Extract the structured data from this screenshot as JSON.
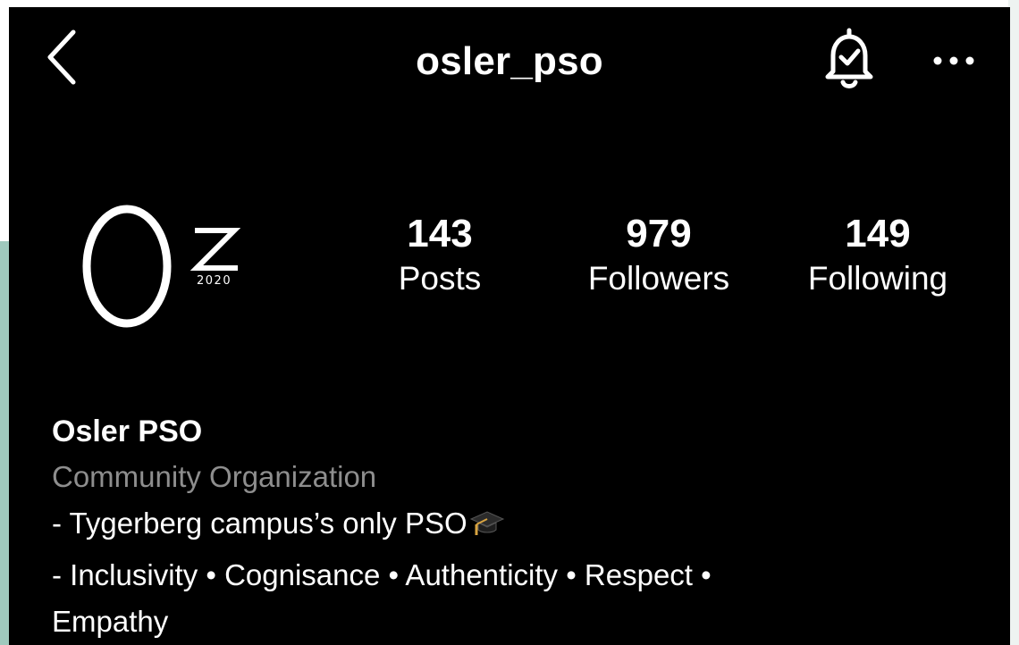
{
  "header": {
    "username": "osler_pso",
    "back_icon": "chevron-left-icon",
    "notify_icon": "bell-check-icon",
    "more_icon": "ellipsis-icon"
  },
  "avatar": {
    "logo_text": "OZ 2020"
  },
  "stats": {
    "posts_count": "143",
    "posts_label": "Posts",
    "followers_count": "979",
    "followers_label": "Followers",
    "following_count": "149",
    "following_label": "Following"
  },
  "bio": {
    "display_name": "Osler PSO",
    "category": "Community Organization",
    "line1": "- Tygerberg campus’s only PSO",
    "line2": "- Inclusivity • Cognisance • Authenticity • Respect •",
    "line3": "Empathy"
  },
  "colors": {
    "screen_bg": "#000000",
    "text": "#ffffff",
    "category_text": "#8e8e8e",
    "left_edge_accent": "#9fc9bd"
  }
}
